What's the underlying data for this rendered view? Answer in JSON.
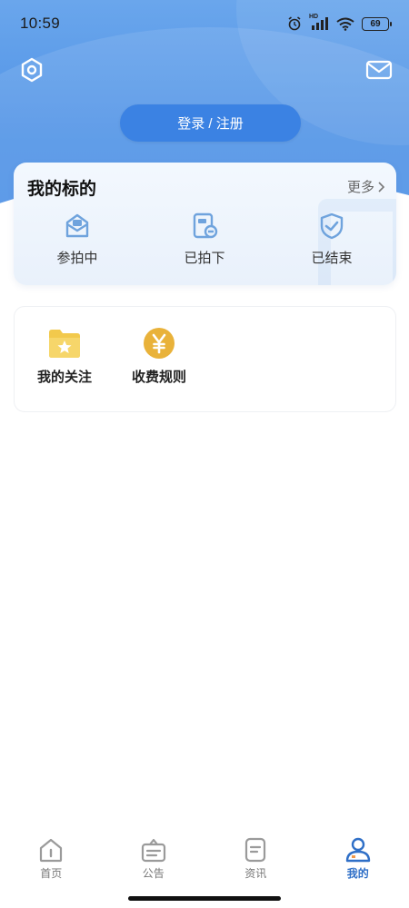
{
  "status": {
    "time": "10:59",
    "battery": "69",
    "hd_label": "HD",
    "icons": [
      "alarm-icon",
      "signal-icon",
      "wifi-icon",
      "battery-icon"
    ]
  },
  "header": {
    "settings_icon": "settings-hex-icon",
    "mail_icon": "mail-icon",
    "login_label": "登录 / 注册"
  },
  "my_bids": {
    "title": "我的标的",
    "more_label": "更多",
    "items": [
      {
        "label": "参拍中",
        "icon": "bidding-icon"
      },
      {
        "label": "已拍下",
        "icon": "won-icon"
      },
      {
        "label": "已结束",
        "icon": "ended-icon"
      }
    ]
  },
  "quick_actions": [
    {
      "label": "我的关注",
      "icon": "star-folder-icon"
    },
    {
      "label": "收费规则",
      "icon": "yen-coin-icon"
    }
  ],
  "tabbar": [
    {
      "label": "首页",
      "icon": "home-icon",
      "active": false
    },
    {
      "label": "公告",
      "icon": "notice-icon",
      "active": false
    },
    {
      "label": "资讯",
      "icon": "news-icon",
      "active": false
    },
    {
      "label": "我的",
      "icon": "profile-icon",
      "active": true
    }
  ],
  "colors": {
    "primary": "#3b82e3",
    "header_top": "#6aa6ec",
    "active_tab": "#2f6fc7",
    "icon_blue": "#6fa3dd",
    "folder_yellow": "#f2c94c",
    "coin_gold": "#e9b23a"
  }
}
